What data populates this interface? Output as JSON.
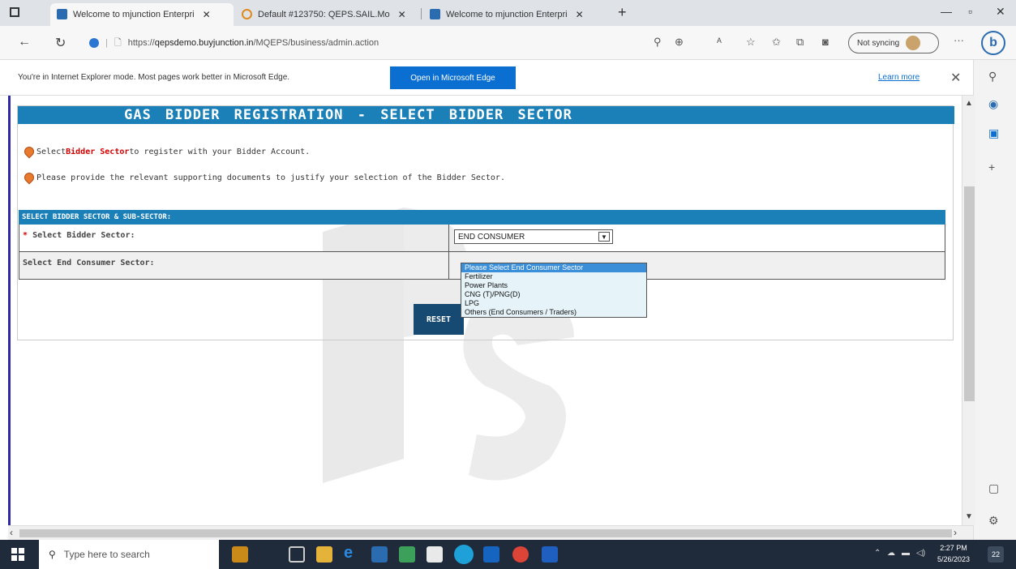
{
  "browser": {
    "tabs": [
      {
        "title": "Welcome to mjunction Enterpri"
      },
      {
        "title": "Default #123750: QEPS.SAIL.Mo"
      },
      {
        "title": "Welcome to mjunction Enterpri"
      }
    ],
    "url_prefix": "https://",
    "url_host": "qepsdemo.buyjunction.in",
    "url_path": "/MQEPS/business/admin.action",
    "sync_label": "Not syncing"
  },
  "ie_bar": {
    "message": "You're in Internet Explorer mode. Most pages work better in Microsoft Edge.",
    "open_button": "Open in Microsoft Edge",
    "learn_more": "Learn more"
  },
  "page": {
    "title": "GAS BIDDER REGISTRATION - SELECT BIDDER SECTOR",
    "note1_pre": "Select ",
    "note1_bold": "Bidder Sector",
    "note1_post": " to register with your Bidder Account.",
    "note2": "Please provide the relevant supporting documents to justify your selection of the Bidder Sector.",
    "section_header": "SELECT BIDDER SECTOR & SUB-SECTOR:",
    "row1_required": "*",
    "row1_label": "Select Bidder Sector:",
    "row1_value": "END CONSUMER",
    "row2_label": "Select End Consumer Sector:",
    "dropdown_options": [
      "Please Select End Consumer Sector",
      "Fertilizer",
      "Power Plants",
      "CNG (T)/PNG(D)",
      "LPG",
      "Others (End Consumers / Traders)"
    ],
    "reset_button": "RESET"
  },
  "taskbar": {
    "search_placeholder": "Type here to search",
    "time": "2:27 PM",
    "date": "5/26/2023",
    "notifications": "22"
  },
  "colors": {
    "header_blue": "#1b7fb8",
    "required_red": "#d40000",
    "dropdown_highlight": "#3a8fd8"
  }
}
